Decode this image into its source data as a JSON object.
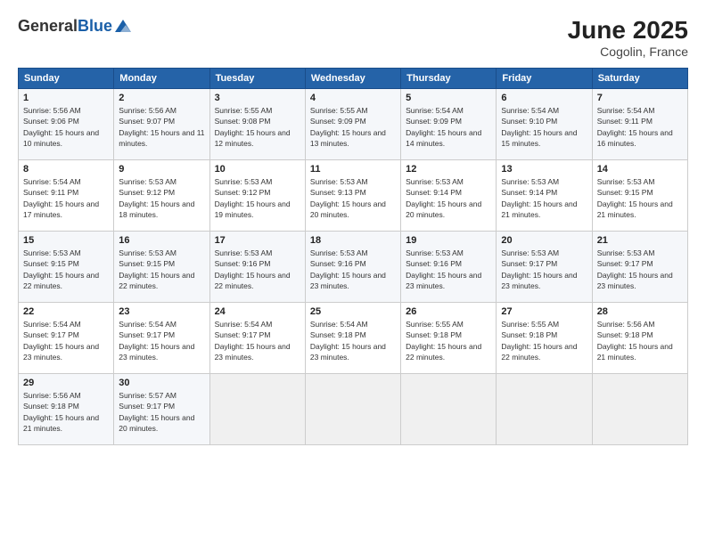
{
  "header": {
    "logo_general": "General",
    "logo_blue": "Blue",
    "month_year": "June 2025",
    "location": "Cogolin, France"
  },
  "weekdays": [
    "Sunday",
    "Monday",
    "Tuesday",
    "Wednesday",
    "Thursday",
    "Friday",
    "Saturday"
  ],
  "weeks": [
    [
      {
        "day": "1",
        "sunrise": "Sunrise: 5:56 AM",
        "sunset": "Sunset: 9:06 PM",
        "daylight": "Daylight: 15 hours and 10 minutes."
      },
      {
        "day": "2",
        "sunrise": "Sunrise: 5:56 AM",
        "sunset": "Sunset: 9:07 PM",
        "daylight": "Daylight: 15 hours and 11 minutes."
      },
      {
        "day": "3",
        "sunrise": "Sunrise: 5:55 AM",
        "sunset": "Sunset: 9:08 PM",
        "daylight": "Daylight: 15 hours and 12 minutes."
      },
      {
        "day": "4",
        "sunrise": "Sunrise: 5:55 AM",
        "sunset": "Sunset: 9:09 PM",
        "daylight": "Daylight: 15 hours and 13 minutes."
      },
      {
        "day": "5",
        "sunrise": "Sunrise: 5:54 AM",
        "sunset": "Sunset: 9:09 PM",
        "daylight": "Daylight: 15 hours and 14 minutes."
      },
      {
        "day": "6",
        "sunrise": "Sunrise: 5:54 AM",
        "sunset": "Sunset: 9:10 PM",
        "daylight": "Daylight: 15 hours and 15 minutes."
      },
      {
        "day": "7",
        "sunrise": "Sunrise: 5:54 AM",
        "sunset": "Sunset: 9:11 PM",
        "daylight": "Daylight: 15 hours and 16 minutes."
      }
    ],
    [
      {
        "day": "8",
        "sunrise": "Sunrise: 5:54 AM",
        "sunset": "Sunset: 9:11 PM",
        "daylight": "Daylight: 15 hours and 17 minutes."
      },
      {
        "day": "9",
        "sunrise": "Sunrise: 5:53 AM",
        "sunset": "Sunset: 9:12 PM",
        "daylight": "Daylight: 15 hours and 18 minutes."
      },
      {
        "day": "10",
        "sunrise": "Sunrise: 5:53 AM",
        "sunset": "Sunset: 9:12 PM",
        "daylight": "Daylight: 15 hours and 19 minutes."
      },
      {
        "day": "11",
        "sunrise": "Sunrise: 5:53 AM",
        "sunset": "Sunset: 9:13 PM",
        "daylight": "Daylight: 15 hours and 20 minutes."
      },
      {
        "day": "12",
        "sunrise": "Sunrise: 5:53 AM",
        "sunset": "Sunset: 9:14 PM",
        "daylight": "Daylight: 15 hours and 20 minutes."
      },
      {
        "day": "13",
        "sunrise": "Sunrise: 5:53 AM",
        "sunset": "Sunset: 9:14 PM",
        "daylight": "Daylight: 15 hours and 21 minutes."
      },
      {
        "day": "14",
        "sunrise": "Sunrise: 5:53 AM",
        "sunset": "Sunset: 9:15 PM",
        "daylight": "Daylight: 15 hours and 21 minutes."
      }
    ],
    [
      {
        "day": "15",
        "sunrise": "Sunrise: 5:53 AM",
        "sunset": "Sunset: 9:15 PM",
        "daylight": "Daylight: 15 hours and 22 minutes."
      },
      {
        "day": "16",
        "sunrise": "Sunrise: 5:53 AM",
        "sunset": "Sunset: 9:15 PM",
        "daylight": "Daylight: 15 hours and 22 minutes."
      },
      {
        "day": "17",
        "sunrise": "Sunrise: 5:53 AM",
        "sunset": "Sunset: 9:16 PM",
        "daylight": "Daylight: 15 hours and 22 minutes."
      },
      {
        "day": "18",
        "sunrise": "Sunrise: 5:53 AM",
        "sunset": "Sunset: 9:16 PM",
        "daylight": "Daylight: 15 hours and 23 minutes."
      },
      {
        "day": "19",
        "sunrise": "Sunrise: 5:53 AM",
        "sunset": "Sunset: 9:16 PM",
        "daylight": "Daylight: 15 hours and 23 minutes."
      },
      {
        "day": "20",
        "sunrise": "Sunrise: 5:53 AM",
        "sunset": "Sunset: 9:17 PM",
        "daylight": "Daylight: 15 hours and 23 minutes."
      },
      {
        "day": "21",
        "sunrise": "Sunrise: 5:53 AM",
        "sunset": "Sunset: 9:17 PM",
        "daylight": "Daylight: 15 hours and 23 minutes."
      }
    ],
    [
      {
        "day": "22",
        "sunrise": "Sunrise: 5:54 AM",
        "sunset": "Sunset: 9:17 PM",
        "daylight": "Daylight: 15 hours and 23 minutes."
      },
      {
        "day": "23",
        "sunrise": "Sunrise: 5:54 AM",
        "sunset": "Sunset: 9:17 PM",
        "daylight": "Daylight: 15 hours and 23 minutes."
      },
      {
        "day": "24",
        "sunrise": "Sunrise: 5:54 AM",
        "sunset": "Sunset: 9:17 PM",
        "daylight": "Daylight: 15 hours and 23 minutes."
      },
      {
        "day": "25",
        "sunrise": "Sunrise: 5:54 AM",
        "sunset": "Sunset: 9:18 PM",
        "daylight": "Daylight: 15 hours and 23 minutes."
      },
      {
        "day": "26",
        "sunrise": "Sunrise: 5:55 AM",
        "sunset": "Sunset: 9:18 PM",
        "daylight": "Daylight: 15 hours and 22 minutes."
      },
      {
        "day": "27",
        "sunrise": "Sunrise: 5:55 AM",
        "sunset": "Sunset: 9:18 PM",
        "daylight": "Daylight: 15 hours and 22 minutes."
      },
      {
        "day": "28",
        "sunrise": "Sunrise: 5:56 AM",
        "sunset": "Sunset: 9:18 PM",
        "daylight": "Daylight: 15 hours and 21 minutes."
      }
    ],
    [
      {
        "day": "29",
        "sunrise": "Sunrise: 5:56 AM",
        "sunset": "Sunset: 9:18 PM",
        "daylight": "Daylight: 15 hours and 21 minutes."
      },
      {
        "day": "30",
        "sunrise": "Sunrise: 5:57 AM",
        "sunset": "Sunset: 9:17 PM",
        "daylight": "Daylight: 15 hours and 20 minutes."
      },
      {
        "day": "",
        "sunrise": "",
        "sunset": "",
        "daylight": ""
      },
      {
        "day": "",
        "sunrise": "",
        "sunset": "",
        "daylight": ""
      },
      {
        "day": "",
        "sunrise": "",
        "sunset": "",
        "daylight": ""
      },
      {
        "day": "",
        "sunrise": "",
        "sunset": "",
        "daylight": ""
      },
      {
        "day": "",
        "sunrise": "",
        "sunset": "",
        "daylight": ""
      }
    ]
  ]
}
